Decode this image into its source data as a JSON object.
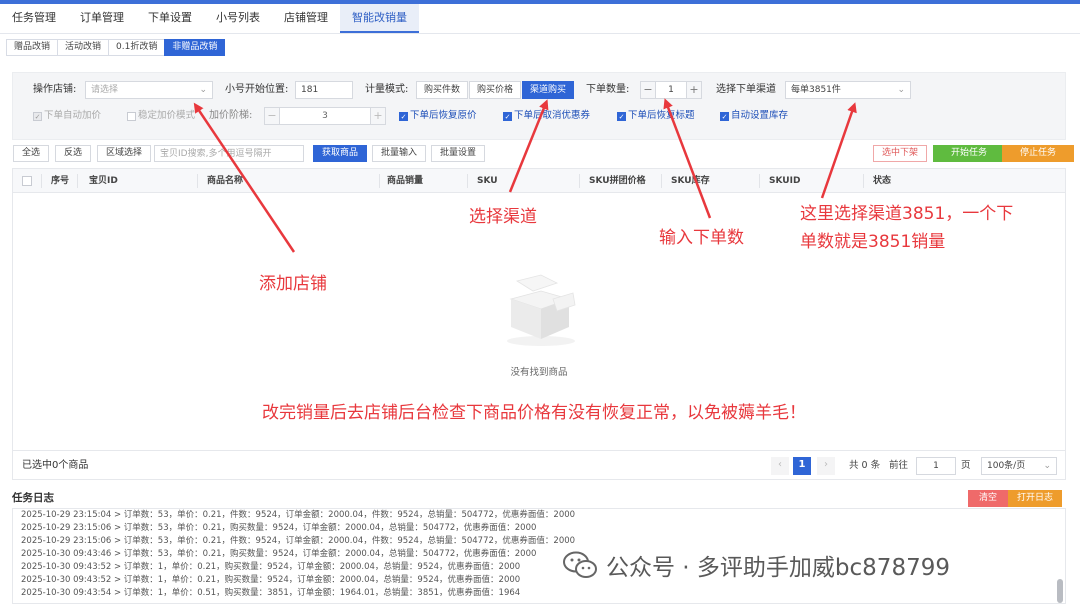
{
  "main_tabs": [
    "任务管理",
    "订单管理",
    "下单设置",
    "小号列表",
    "店铺管理",
    "智能改销量"
  ],
  "main_tab_active": 5,
  "sub_tabs": [
    "赠品改销",
    "活动改销",
    "0.1折改销",
    "非赠品改销"
  ],
  "sub_tab_active": 3,
  "form": {
    "shop_label": "操作店铺:",
    "shop_placeholder": "请选择",
    "start_pos_label": "小号开始位置:",
    "start_pos_value": "181",
    "count_mode_label": "计量模式:",
    "count_modes": [
      "购买件数",
      "购买价格",
      "渠道购买"
    ],
    "count_mode_active": 2,
    "order_qty_label": "下单数量:",
    "order_qty_value": "1",
    "channel_label": "选择下单渠道",
    "channel_value": "每单3851件",
    "auto_markup": "下单自动加价",
    "stable_markup": "稳定加价模式",
    "markup_step_label": "加价阶梯:",
    "markup_step_value": "3",
    "restore_price": "下单后恢复原价",
    "cancel_coupon": "下单后取消优惠券",
    "restore_title": "下单后恢复标题",
    "auto_stock": "自动设置库存",
    "minus": "−",
    "plus": "+"
  },
  "toolbar": {
    "select_all": "全选",
    "invert": "反选",
    "range_select": "区域选择",
    "search_placeholder": "宝贝ID搜索,多个用逗号隔开",
    "fetch": "获取商品",
    "batch_input": "批量输入",
    "batch_set": "批量设置",
    "select_delist": "选中下架",
    "start_task": "开始任务",
    "stop_task": "停止任务"
  },
  "table": {
    "columns": [
      "序号",
      "宝贝ID",
      "商品名称",
      "商品销量",
      "SKU",
      "SKU拼团价格",
      "SKU库存",
      "SKUID",
      "状态"
    ],
    "empty_text": "没有找到商品"
  },
  "footer": {
    "selected": "已选中0个商品",
    "page": "1",
    "total": "共 0 条",
    "goto_label": "前往",
    "goto_value": "1",
    "page_unit": "页",
    "page_size": "100条/页",
    "prev": "‹",
    "next": "›"
  },
  "log": {
    "title": "任务日志",
    "clear": "清空",
    "open_log": "打开日志",
    "lines": [
      "2025-10-29 23:15:04 > 订单数：53，单价：0.21，件数：9524，订单金额：2000.04，件数：9524，总销量：504772，优惠券面值：2000",
      "2025-10-29 23:15:06 > 订单数：53，单价：0.21，购买数量：9524，订单金额：2000.04，总销量：504772，优惠券面值：2000",
      "2025-10-29 23:15:06 > 订单数：53，单价：0.21，件数：9524，订单金额：2000.04，件数：9524，总销量：504772，优惠券面值：2000",
      "2025-10-30 09:43:46 > 订单数：53，单价：0.21，购买数量：9524，订单金额：2000.04，总销量：504772，优惠券面值：2000",
      "2025-10-30 09:43:52 > 订单数：1，单价：0.21，购买数量：9524，订单金额：2000.04，总销量：9524，优惠券面值：2000",
      "2025-10-30 09:43:52 > 订单数：1，单价：0.21，购买数量：9524，订单金额：2000.04，总销量：9524，优惠券面值：2000",
      "2025-10-30 09:43:54 > 订单数：1，单价：0.51，购买数量：3851，订单金额：1964.01，总销量：3851，优惠券面值：1964"
    ]
  },
  "annotations": {
    "add_shop": "添加店铺",
    "select_channel": "选择渠道",
    "input_qty": "输入下单数",
    "channel_note_1": "这里选择渠道3851，一个下",
    "channel_note_2": "单数就是3851销量",
    "bottom_note": "改完销量后去店铺后台检查下商品价格有没有恢复正常，以免被薅羊毛！"
  },
  "watermark": "公众号 · 多评助手加威bc878799",
  "colors": {
    "accent": "#2f65d6",
    "annotation": "#e8383d",
    "start_green": "#5fbb3f",
    "stop_orange": "#ee9c2c"
  }
}
